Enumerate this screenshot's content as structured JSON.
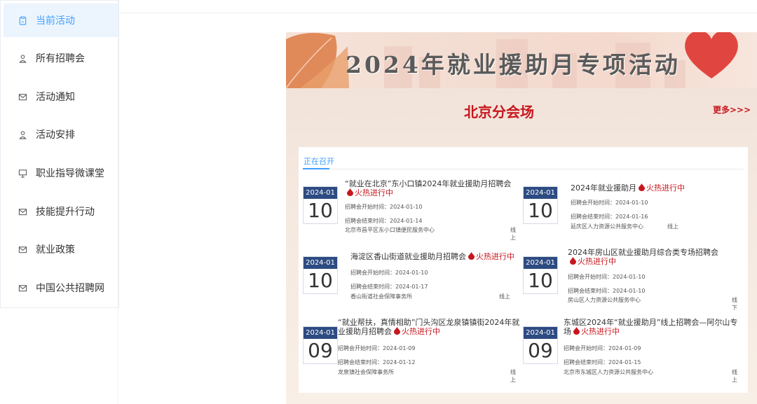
{
  "sidebar": {
    "items": [
      {
        "label": "当前活动",
        "icon": "clipboard-icon",
        "active": true
      },
      {
        "label": "所有招聘会",
        "icon": "user-icon"
      },
      {
        "label": "活动通知",
        "icon": "mail-icon"
      },
      {
        "label": "活动安排",
        "icon": "user-icon"
      },
      {
        "label": "职业指导微课堂",
        "icon": "presentation-icon"
      },
      {
        "label": "技能提升行动",
        "icon": "mail-icon"
      },
      {
        "label": "就业政策",
        "icon": "mail-icon"
      },
      {
        "label": "中国公共招聘网",
        "icon": "mail-icon"
      }
    ]
  },
  "banner": {
    "title": "2024年就业援助月专项活动"
  },
  "venue": {
    "title": "北京分会场",
    "more": "更多>>>"
  },
  "tabs": {
    "active": "正在召开"
  },
  "labels": {
    "hot": "火热进行中",
    "start_prefix": "招聘会开始时间：",
    "end_prefix": "招聘会结束时间："
  },
  "events": [
    {
      "ym": "2024-01",
      "day": "10",
      "title": "“就业在北京”东小口镇2024年就业援助月招聘会",
      "start": "招聘会开始时间：2024-01-10",
      "end": "招聘会结束时间：2024-01-14",
      "org": "北京市昌平区东小口镇便民服务中心",
      "mode": "线上"
    },
    {
      "ym": "2024-01",
      "day": "10",
      "title": "2024年就业援助月",
      "start": "招聘会开始时间：2024-01-10",
      "end": "招聘会结束时间：2024-01-16",
      "org": "延庆区人力资源公共服务中心",
      "mode": "线上"
    },
    {
      "ym": "2024-01",
      "day": "10",
      "title": "海淀区香山街道就业援助月招聘会",
      "start": "招聘会开始时间：2024-01-10",
      "end": "招聘会结束时间：2024-01-17",
      "org": "香山街道社会保障事务所",
      "mode": "线上"
    },
    {
      "ym": "2024-01",
      "day": "10",
      "title": "2024年房山区就业援助月综合类专场招聘会",
      "start": "招聘会开始时间：2024-01-10",
      "end": "招聘会结束时间：2024-01-10",
      "org": "房山区人力资源公共服务中心",
      "mode": "线下"
    },
    {
      "ym": "2024-01",
      "day": "09",
      "title": "“就业帮扶，真情相助”门头沟区龙泉镇镇街2024年就业援助月招聘会",
      "start": "招聘会开始时间：2024-01-09",
      "end": "招聘会结束时间：2024-01-12",
      "org": "龙泉镇社会保障事务所",
      "mode": "线上"
    },
    {
      "ym": "2024-01",
      "day": "09",
      "title": "东城区2024年“就业援助月”线上招聘会—阿尔山专场",
      "start": "招聘会开始时间：2024-01-09",
      "end": "招聘会结束时间：2024-01-15",
      "org": "北京市东城区人力资源公共服务中心",
      "mode": "线上"
    }
  ],
  "colors": {
    "accent": "#409eff",
    "red": "#c8161d",
    "navy": "#2d4b82"
  }
}
